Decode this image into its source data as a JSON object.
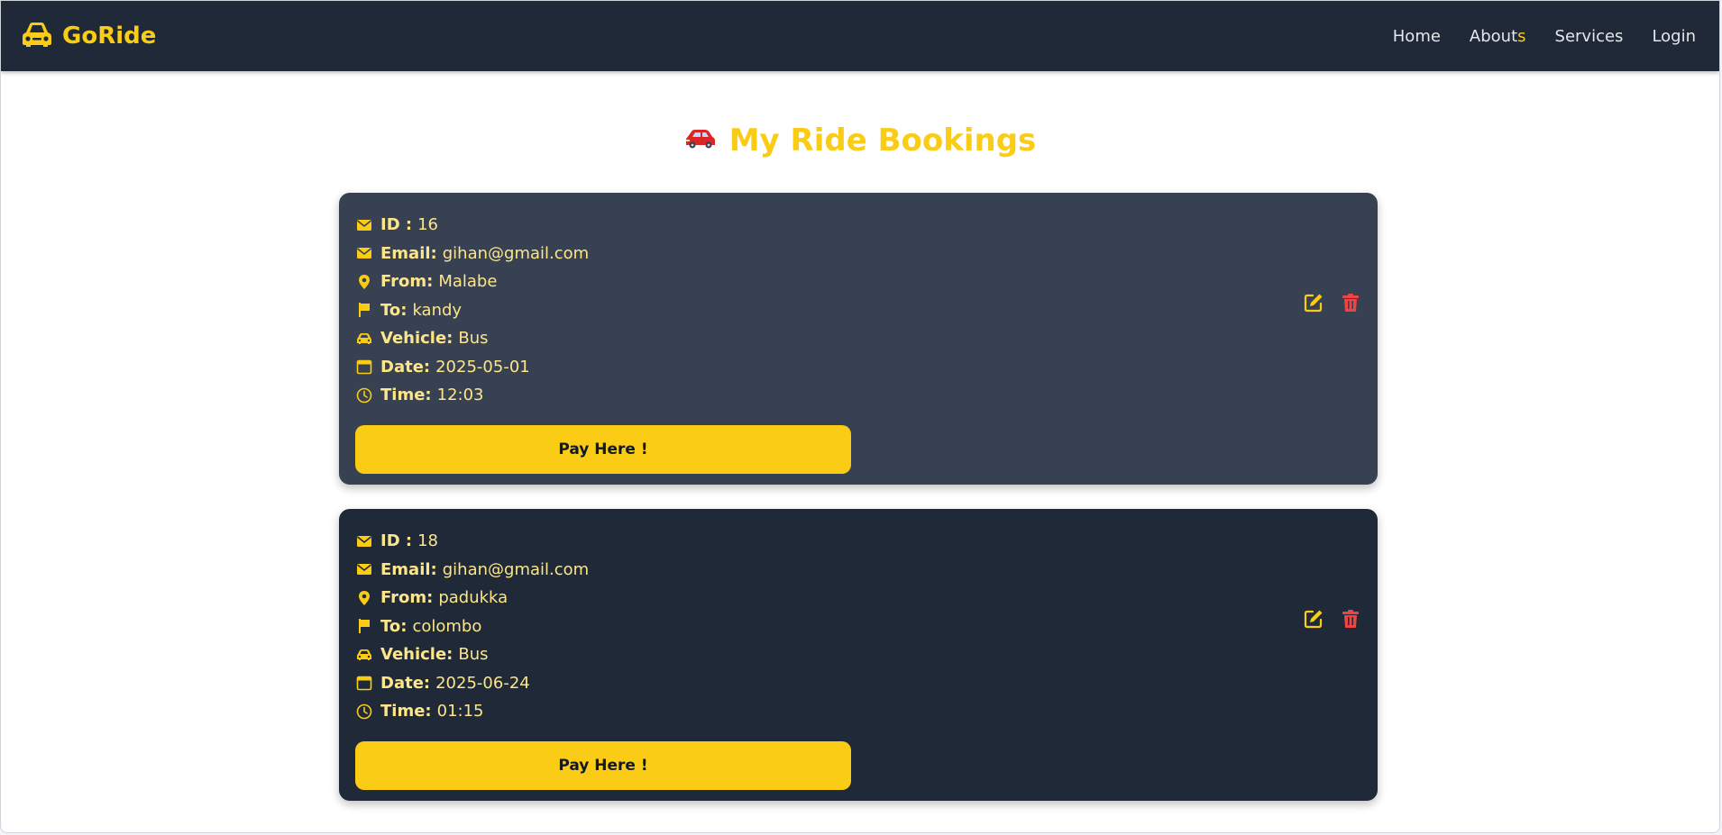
{
  "navbar": {
    "brand": "GoRide",
    "links": [
      {
        "label": "Home"
      },
      {
        "label_main": "About",
        "label_accent": "s"
      },
      {
        "label": "Services"
      },
      {
        "label": "Login"
      }
    ]
  },
  "page": {
    "title": "My Ride Bookings"
  },
  "labels": {
    "id": "ID :",
    "email": "Email:",
    "from": "From:",
    "to": "To:",
    "vehicle": "Vehicle:",
    "date": "Date:",
    "time": "Time:"
  },
  "bookings": [
    {
      "id": "16",
      "email": "gihan@gmail.com",
      "from": "Malabe",
      "to": "kandy",
      "vehicle": "Bus",
      "date": "2025-05-01",
      "time": "12:03",
      "pay_label": "Pay Here !"
    },
    {
      "id": "18",
      "email": "gihan@gmail.com",
      "from": "padukka",
      "to": "colombo",
      "vehicle": "Bus",
      "date": "2025-06-24",
      "time": "01:15",
      "pay_label": "Pay Here !"
    }
  ],
  "colors": {
    "accent": "#facc15",
    "navbar": "#1f2937",
    "card_highlight": "#374151",
    "card": "#1f2937",
    "delete": "#ef4444"
  },
  "icons": {
    "brand": "car-icon",
    "heading": "red-car-icon",
    "id": "envelope-icon",
    "email": "envelope-icon",
    "from": "map-pin-icon",
    "to": "flag-icon",
    "vehicle": "car-icon",
    "date": "calendar-icon",
    "time": "clock-icon",
    "edit": "edit-icon",
    "delete": "trash-icon"
  }
}
